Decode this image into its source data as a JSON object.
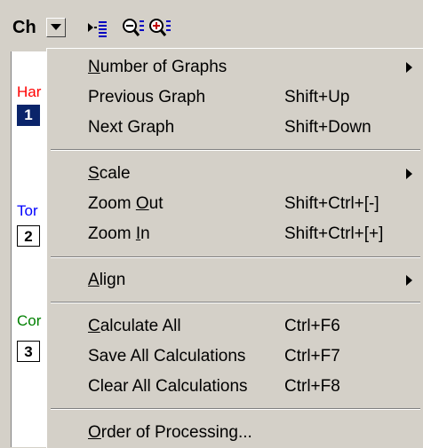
{
  "toolbar": {
    "channel_label": "Ch",
    "dropdown_icon": "chevron-down-icon",
    "icons": [
      "expand-list-icon",
      "zoom-out-icon",
      "zoom-in-icon"
    ]
  },
  "traces": [
    {
      "name": "Har",
      "number": "1",
      "color": "#ff0000",
      "selected": true
    },
    {
      "name": "Tor",
      "number": "2",
      "color": "#0000ff",
      "selected": false
    },
    {
      "name": "Cor",
      "number": "3",
      "color": "#008000",
      "selected": false
    }
  ],
  "menu": {
    "number_of_graphs": {
      "prefix": "",
      "key": "N",
      "rest": "umber of Graphs"
    },
    "previous_graph": {
      "label": "Previous Graph",
      "shortcut": "Shift+Up"
    },
    "next_graph": {
      "label": "Next Graph",
      "shortcut": "Shift+Down"
    },
    "scale": {
      "prefix": "",
      "key": "S",
      "rest": "cale"
    },
    "zoom_out": {
      "prefix": "Zoom ",
      "key": "O",
      "rest": "ut",
      "shortcut": "Shift+Ctrl+[-]"
    },
    "zoom_in": {
      "prefix": "Zoom ",
      "key": "I",
      "rest": "n",
      "shortcut": "Shift+Ctrl+[+]"
    },
    "align": {
      "prefix": "",
      "key": "A",
      "rest": "lign"
    },
    "calculate_all": {
      "prefix": "",
      "key": "C",
      "rest": "alculate All",
      "shortcut": "Ctrl+F6"
    },
    "save_all": {
      "label": "Save All Calculations",
      "shortcut": "Ctrl+F7"
    },
    "clear_all": {
      "label": "Clear All Calculations",
      "shortcut": "Ctrl+F8"
    },
    "order_of_processing": {
      "prefix": "",
      "key": "O",
      "rest": "rder of Processing..."
    }
  }
}
